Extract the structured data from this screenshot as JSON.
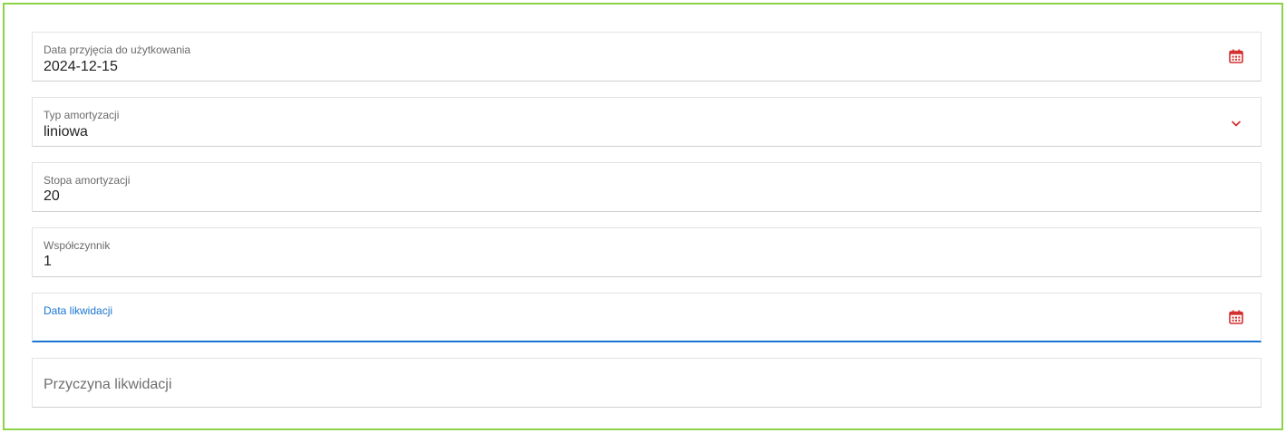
{
  "form": {
    "date_accepted": {
      "label": "Data przyjęcia do użytkowania",
      "value": "2024-12-15",
      "icon": "calendar-icon"
    },
    "depreciation_type": {
      "label": "Typ amortyzacji",
      "value": "liniowa",
      "icon": "chevron-down-icon"
    },
    "depreciation_rate": {
      "label": "Stopa amortyzacji",
      "value": "20"
    },
    "coefficient": {
      "label": "Współczynnik",
      "value": "1"
    },
    "liquidation_date": {
      "label": "Data likwidacji",
      "value": "",
      "icon": "calendar-icon"
    },
    "liquidation_reason": {
      "placeholder": "Przyczyna likwidacji",
      "value": ""
    }
  },
  "colors": {
    "frame_border": "#8dd34a",
    "icon_red": "#d32f2f",
    "focus_blue": "#1976d2"
  }
}
